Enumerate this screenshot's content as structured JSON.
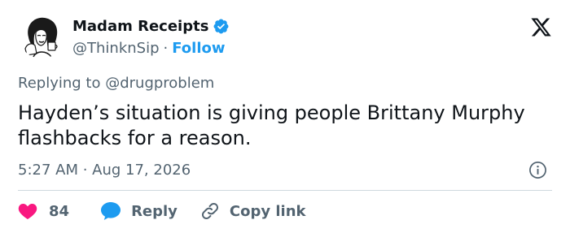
{
  "author": {
    "display_name": "Madam Receipts",
    "handle": "@ThinknSip",
    "separator": "·",
    "follow_label": "Follow",
    "verified_color": "#1d9bf0"
  },
  "tweet": {
    "replying_prefix": "Replying to ",
    "replying_to": "@drugproblem",
    "text": "Hayden’s situation is giving people Brittany Murphy flashbacks for a reason.",
    "timestamp": "5:27 AM · Aug 17, 2026"
  },
  "actions": {
    "like_count": "84",
    "reply_label": "Reply",
    "copy_label": "Copy link"
  },
  "icons": {
    "x_logo": "x-logo-icon",
    "verified": "verified-badge-icon",
    "info": "info-icon",
    "like": "heart-icon",
    "reply": "speech-bubble-icon",
    "copy": "link-icon"
  },
  "colors": {
    "text": "#0f1419",
    "secondary": "#536471",
    "accent": "#1d9bf0",
    "like": "#f91880",
    "divider": "#cfd9de"
  }
}
